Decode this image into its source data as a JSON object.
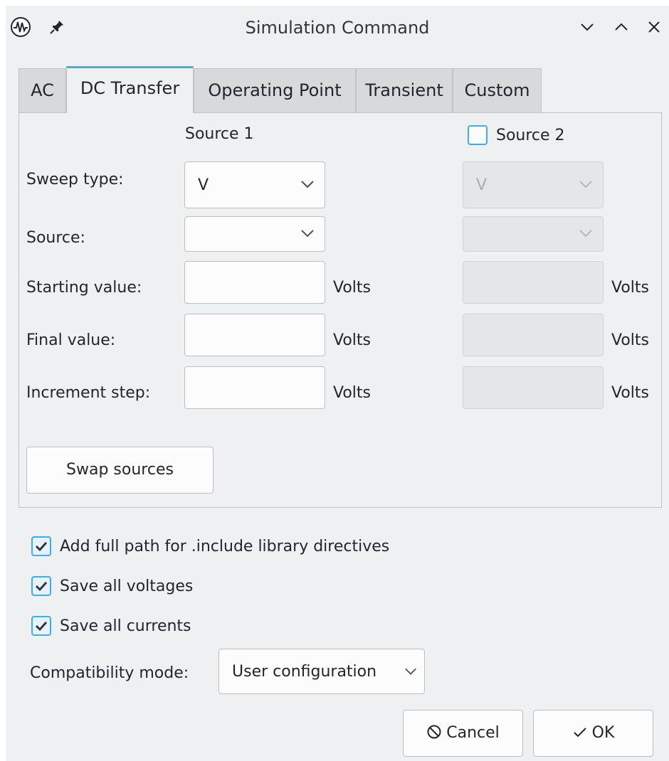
{
  "window": {
    "title": "Simulation Command"
  },
  "icons": {
    "app": "simulator-waveform-icon",
    "pin": "pin-icon",
    "minimize": "chevron-down-icon",
    "maximize": "chevron-up-icon",
    "close": "close-icon"
  },
  "tabs": [
    {
      "label": "AC",
      "active": false
    },
    {
      "label": "DC Transfer",
      "active": true
    },
    {
      "label": "Operating Point",
      "active": false
    },
    {
      "label": "Transient",
      "active": false
    },
    {
      "label": "Custom",
      "active": false
    }
  ],
  "dc": {
    "source1_header": "Source 1",
    "source2_label": "Source 2",
    "source2_checked": false,
    "labels": {
      "sweep_type": "Sweep type:",
      "source": "Source:",
      "starting_value": "Starting value:",
      "final_value": "Final value:",
      "increment_step": "Increment step:"
    },
    "units": {
      "volts": "Volts"
    },
    "source1": {
      "sweep_type": "V",
      "source": "",
      "start": "",
      "final": "",
      "step": ""
    },
    "source2": {
      "sweep_type": "V",
      "source": "",
      "start": "",
      "final": "",
      "step": "",
      "enabled": false
    },
    "swap_label": "Swap sources"
  },
  "options": [
    {
      "label": "Add full path for .include library directives",
      "checked": true
    },
    {
      "label": "Save all voltages",
      "checked": true
    },
    {
      "label": "Save all currents",
      "checked": true
    }
  ],
  "compat": {
    "label": "Compatibility mode:",
    "value": "User configuration"
  },
  "buttons": {
    "cancel": "Cancel",
    "ok": "OK"
  },
  "colors": {
    "accent": "#3daee9",
    "window_bg": "#eff0f1",
    "tab_inactive": "#d8d9da"
  }
}
